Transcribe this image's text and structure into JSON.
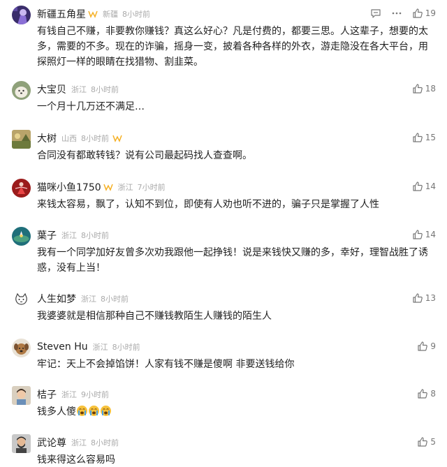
{
  "comments": [
    {
      "username": "新疆五角星",
      "location": "新疆",
      "time": "8小时前",
      "text": "有钱自己不赚，非要教你赚钱？真这么好心？凡是付费的，都要三思。人这辈子，想要的太多，需要的不多。现在的诈骗，摇身一变，披着各种各样的外衣，游走隐没在各大平台，用探照灯一样的眼睛在找猎物、割韭菜。",
      "likes": "19",
      "badge": true,
      "avatar": "purple-figure-avatar",
      "show_reply_more": true
    },
    {
      "username": "大宝贝",
      "location": "浙江",
      "time": "8小时前",
      "text": "一个月十几万还不满足…",
      "likes": "18",
      "avatar": "white-puppy-avatar"
    },
    {
      "username": "大树",
      "location": "山西",
      "time": "8小时前",
      "text": "合同没有都敢转钱？说有公司最起码找人查查啊。",
      "likes": "15",
      "badge": true,
      "avatar": "landscape-avatar"
    },
    {
      "username": "猫咪小鱼1750",
      "location": "浙江",
      "time": "7小时前",
      "text": "来钱太容易，飘了，认知不到位，即使有人劝也听不进的，骗子只是掌握了人性",
      "likes": "14",
      "badge": true,
      "avatar": "red-dancer-avatar"
    },
    {
      "username": "葉子",
      "location": "浙江",
      "time": "8小时前",
      "text": "我有一个同学加好友曾多次劝我跟他一起挣钱！说是来钱快又赚的多，幸好，理智战胜了诱惑，没有上当！",
      "likes": "14",
      "avatar": "water-lily-avatar"
    },
    {
      "username": "人生如梦",
      "location": "浙江",
      "time": "8小时前",
      "text": "我婆婆就是相信那种自己不赚钱教陌生人赚钱的陌生人",
      "likes": "13",
      "avatar": "cartoon-cat-avatar"
    },
    {
      "username": "Steven Hu",
      "location": "浙江",
      "time": "8小时前",
      "text": "牢记：天上不会掉馅饼！人家有钱不赚是傻啊 非要送钱给你",
      "likes": "9",
      "avatar": "brown-dog-avatar"
    },
    {
      "username": "桔子",
      "location": "浙江",
      "time": "9小时前",
      "text": "钱多人傻",
      "likes": "8",
      "avatar": "child-photo-avatar",
      "emojis": [
        "crying-face-emoji",
        "crying-face-emoji",
        "crying-face-emoji"
      ]
    },
    {
      "username": "武论尊",
      "location": "浙江",
      "time": "8小时前",
      "text": "钱来得这么容易吗",
      "likes": "5",
      "avatar": "bearded-man-avatar"
    }
  ],
  "icons": {
    "reply": "comment-bubble-icon",
    "more": "more-dots-icon",
    "like": "thumbs-up-icon"
  },
  "colors": {
    "meta": "#aaaaaa",
    "text": "#222222",
    "badge": "#f5b025"
  }
}
